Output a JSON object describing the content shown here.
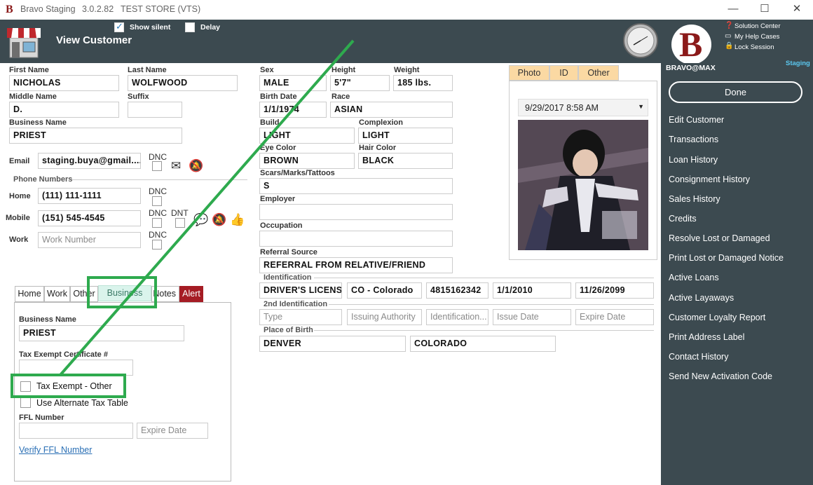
{
  "titlebar": {
    "logo": "B",
    "app_name": "Bravo Staging",
    "version": "3.0.2.82",
    "store": "TEST STORE (VTS)",
    "minimize": "—",
    "maximize": "☐",
    "close": "✕"
  },
  "header": {
    "title": "View Customer",
    "show_silent_label": "Show silent",
    "delay_label": "Delay",
    "solution_center": "Solution Center",
    "my_help_cases": "My Help Cases",
    "lock_session": "Lock Session",
    "user": "BRAVO@MAX",
    "env": "Staging",
    "brand_letter": "B"
  },
  "sidebar": {
    "done": "Done",
    "items": [
      "Edit Customer",
      "Transactions",
      "Loan History",
      "Consignment History",
      "Sales History",
      "Credits",
      "Resolve Lost or Damaged",
      "Print Lost or Damaged Notice",
      "Active Loans",
      "Active Layaways",
      "Customer Loyalty Report",
      "Print Address Label",
      "Contact History",
      "Send New Activation Code"
    ]
  },
  "customer": {
    "first_name_label": "First Name",
    "first_name": "NICHOLAS",
    "last_name_label": "Last Name",
    "last_name": "WOLFWOOD",
    "middle_name_label": "Middle Name",
    "middle_name": "D.",
    "suffix_label": "Suffix",
    "suffix": "",
    "business_name_label": "Business Name",
    "business_name": "PRIEST",
    "email_label": "Email",
    "email": "staging.buya@gmail....",
    "dnc_label": "DNC",
    "dnt_label": "DNT",
    "phone_section": "Phone Numbers",
    "home_label": "Home",
    "home": "(111) 111-1111",
    "mobile_label": "Mobile",
    "mobile": "(151) 545-4545",
    "work_label": "Work",
    "work_placeholder": "Work Number",
    "sex_label": "Sex",
    "sex": "MALE",
    "height_label": "Height",
    "height": "5'7\"",
    "weight_label": "Weight",
    "weight": "185 lbs.",
    "birth_date_label": "Birth Date",
    "birth_date": "1/1/1974",
    "race_label": "Race",
    "race": "ASIAN",
    "build_label": "Build",
    "build": "LIGHT",
    "complexion_label": "Complexion",
    "complexion": "LIGHT",
    "eye_color_label": "Eye Color",
    "eye_color": "BROWN",
    "hair_color_label": "Hair Color",
    "hair_color": "BLACK",
    "scars_label": "Scars/Marks/Tattoos",
    "scars": "S",
    "employer_label": "Employer",
    "employer": "",
    "occupation_label": "Occupation",
    "occupation": "",
    "referral_label": "Referral Source",
    "referral": "REFERRAL FROM RELATIVE/FRIEND"
  },
  "identification": {
    "section": "Identification",
    "type": "DRIVER'S LICENSE",
    "authority": "CO - Colorado",
    "number": "4815162342",
    "issue_date": "1/1/2010",
    "expire_date": "11/26/2099",
    "section2": "2nd Identification",
    "type_ph": "Type",
    "authority_ph": "Issuing Authority",
    "number_ph": "Identification...",
    "issue_ph": "Issue Date",
    "expire_ph": "Expire Date",
    "birth_section": "Place of Birth",
    "birth_city": "DENVER",
    "birth_state": "COLORADO"
  },
  "photo": {
    "tabs": [
      "Photo",
      "ID",
      "Other"
    ],
    "date": "9/29/2017 8:58 AM"
  },
  "tabs": [
    "Home",
    "Work",
    "Other",
    "Business",
    "Notes",
    "Alert"
  ],
  "business_tab": {
    "business_name_label": "Business Name",
    "business_name": "PRIEST",
    "tax_cert_label": "Tax Exempt Certificate #",
    "tax_exempt_other": "Tax Exempt - Other",
    "alt_tax_table": "Use Alternate Tax Table",
    "ffl_label": "FFL Number",
    "ffl_expire_ph": "Expire Date",
    "verify_ffl": "Verify FFL Number"
  },
  "colors": {
    "header_bg": "#3c4a50",
    "highlight": "#2eaa4e",
    "alert_tab": "#a51c24",
    "photo_tab": "#fbd9a3",
    "env_text": "#5bc8f0"
  }
}
